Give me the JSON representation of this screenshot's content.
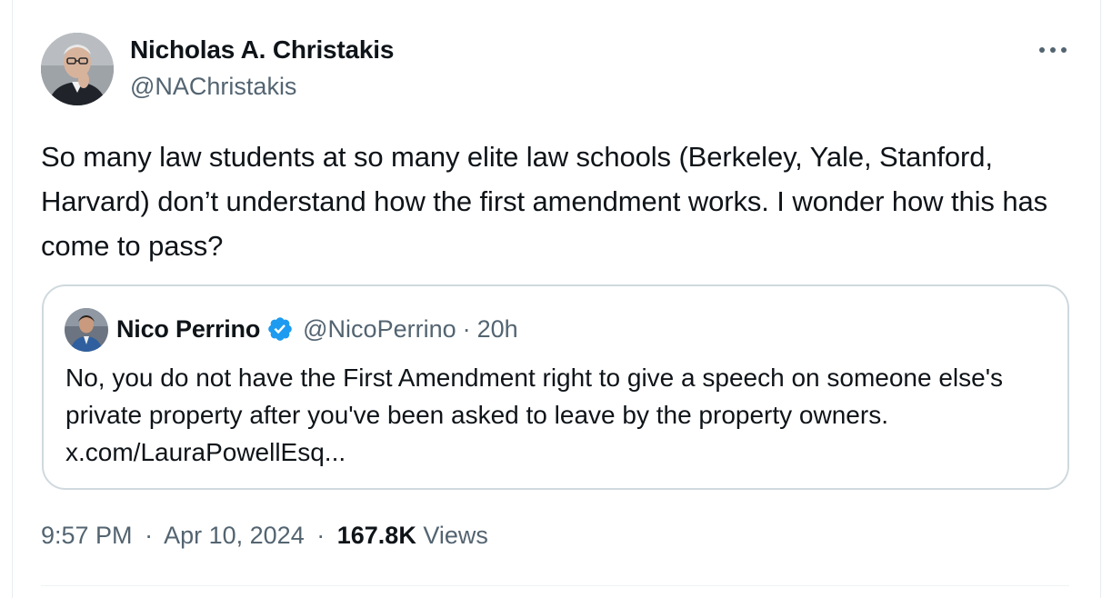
{
  "author": {
    "display_name": "Nicholas A. Christakis",
    "handle": "@NAChristakis"
  },
  "tweet": {
    "text": "So many law students at so many elite law schools (Berkeley, Yale, Stanford, Harvard) don’t understand how the first amendment works. I wonder how this has come to pass?"
  },
  "quote": {
    "display_name": "Nico Perrino",
    "verified": true,
    "handle": "@NicoPerrino",
    "separator": "·",
    "time": "20h",
    "text": "No, you do not have the First Amendment right to give a speech on someone else's private property after you've been asked to leave by the property owners. x.com/LauraPowellEsq..."
  },
  "meta": {
    "time": "9:57 PM",
    "separator": "·",
    "date": "Apr 10, 2024",
    "views_count": "167.8K",
    "views_label": "Views"
  },
  "icons": {
    "more": "more-horizontal-icon",
    "verified": "verified-badge-icon"
  },
  "colors": {
    "text_primary": "#0f1419",
    "text_secondary": "#536471",
    "border": "#cfd9de",
    "verified_blue": "#1d9bf0"
  }
}
